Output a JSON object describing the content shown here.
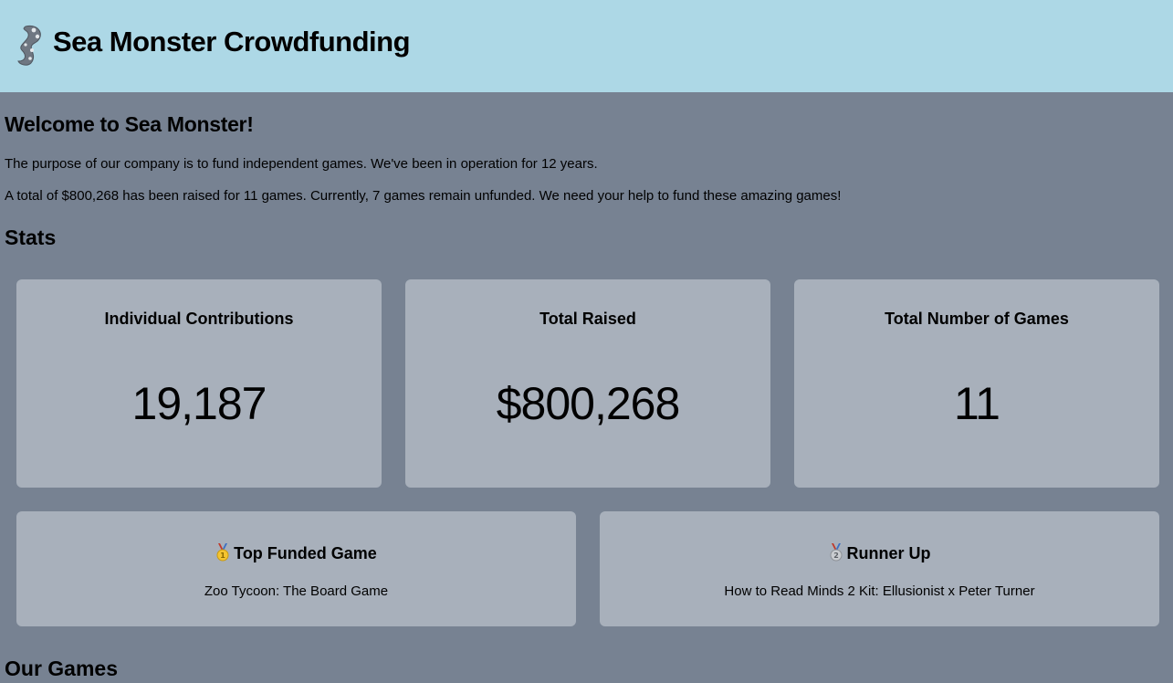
{
  "header": {
    "logo_icon": "sea-monster-tentacle-icon",
    "title": "Sea Monster Crowdfunding"
  },
  "intro": {
    "heading": "Welcome to Sea Monster!",
    "purpose": "The purpose of our company is to fund independent games. We've been in operation for 12 years.",
    "summary": "A total of $800,268 has been raised for 11 games. Currently, 7 games remain unfunded. We need your help to fund these amazing games!"
  },
  "stats": {
    "heading": "Stats",
    "cards": [
      {
        "label": "Individual Contributions",
        "value": "19,187"
      },
      {
        "label": "Total Raised",
        "value": "$800,268"
      },
      {
        "label": "Total Number of Games",
        "value": "11"
      }
    ]
  },
  "top_games": {
    "first": {
      "icon": "gold-medal-icon",
      "heading": "Top Funded Game",
      "name": "Zoo Tycoon: The Board Game"
    },
    "second": {
      "icon": "silver-medal-icon",
      "heading": "Runner Up",
      "name": "How to Read Minds 2 Kit: Ellusionist x Peter Turner"
    }
  },
  "games_section": {
    "heading": "Our Games"
  },
  "colors": {
    "header_bg": "#add8e6",
    "page_bg": "#778292",
    "card_bg": "#a8b0bb"
  }
}
